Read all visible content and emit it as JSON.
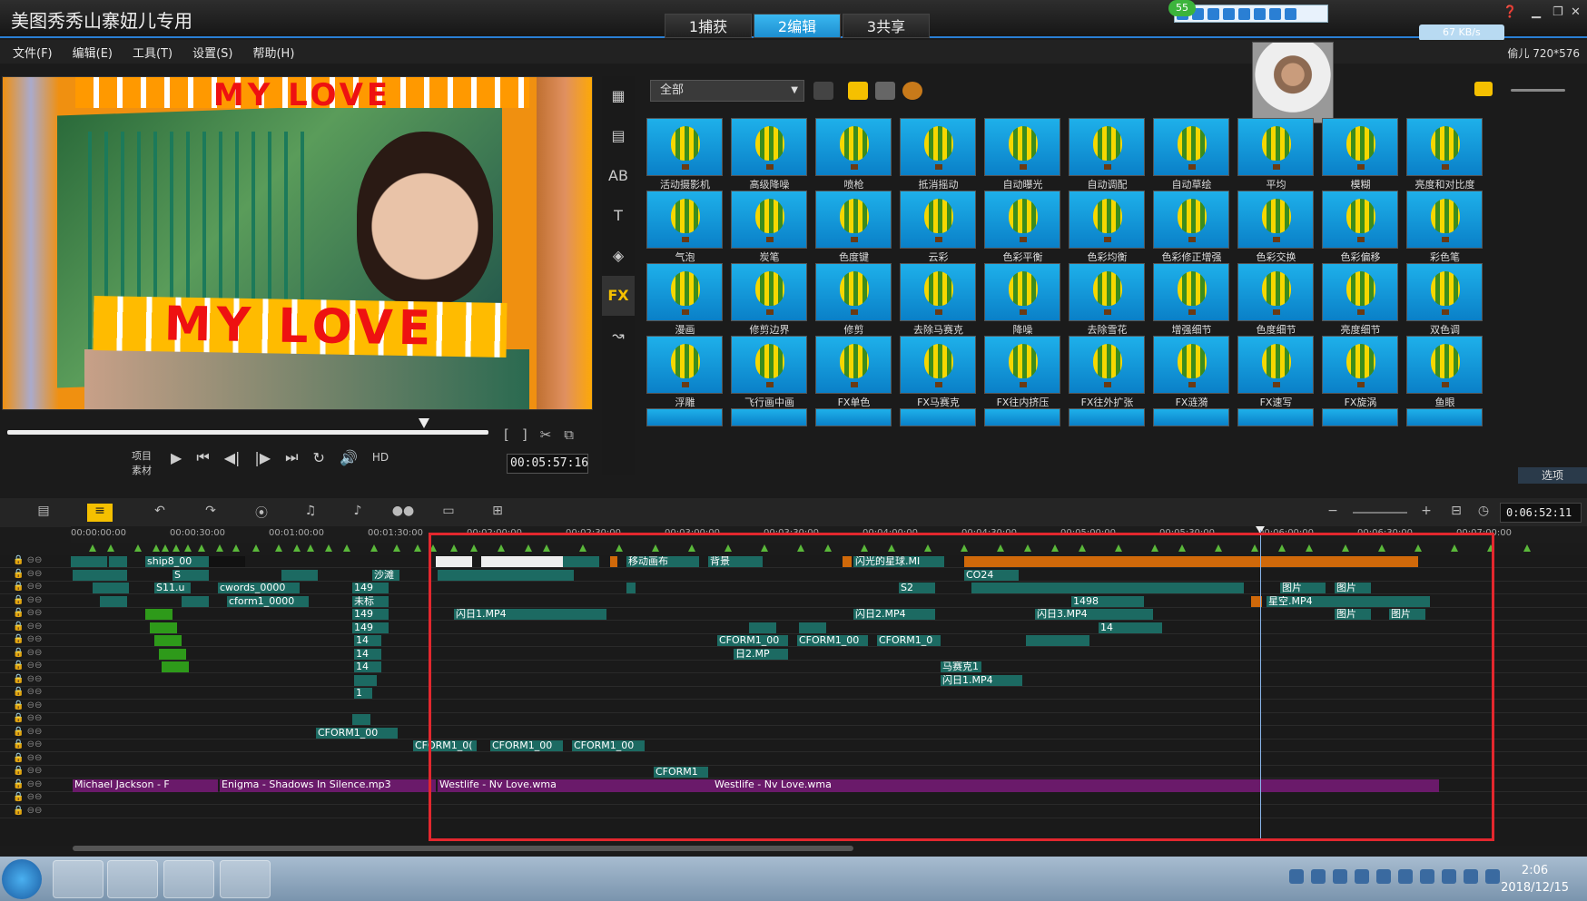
{
  "app": {
    "title": "美图秀秀山寨妞儿专用",
    "mode_tabs": [
      "1捕获",
      "2编辑",
      "3共享"
    ],
    "active_mode": 1
  },
  "menu": [
    "文件(F)",
    "编辑(E)",
    "工具(T)",
    "设置(S)",
    "帮助(H)"
  ],
  "resolution_label": "偷儿 720*576",
  "qq_badge": "55",
  "net_speed": "67 KB/s",
  "preview": {
    "banner_top": "MY LOVE",
    "banner_bottom": "MY LOVE",
    "project_label": "项目",
    "clip_label": "素材",
    "hd_label": "HD",
    "timecode": "00:05:57:16"
  },
  "library": {
    "filter_value": "全部",
    "sidebar": [
      "media-icon",
      "instant-project-icon",
      "transition-icon",
      "title-icon",
      "graphic-icon",
      "filter-icon",
      "path-icon"
    ],
    "options_tab": "选项",
    "effects": [
      "活动摄影机",
      "高级降噪",
      "喷枪",
      "抵消摇动",
      "自动曝光",
      "自动调配",
      "自动草绘",
      "平均",
      "模糊",
      "亮度和对比度",
      "气泡",
      "炭笔",
      "色度键",
      "云彩",
      "色彩平衡",
      "色彩均衡",
      "色彩修正增强",
      "色彩交换",
      "色彩偏移",
      "彩色笔",
      "漫画",
      "修剪边界",
      "修剪",
      "去除马赛克",
      "降噪",
      "去除雪花",
      "增强细节",
      "色度细节",
      "亮度细节",
      "双色调",
      "浮雕",
      "飞行画中画",
      "FX单色",
      "FX马赛克",
      "FX往内挤压",
      "FX往外扩张",
      "FX涟漪",
      "FX速写",
      "FX旋涡",
      "鱼眼"
    ]
  },
  "timeline": {
    "timecode": "0:06:52:11",
    "ruler": [
      "00:00:00:00",
      "00:00:30:00",
      "00:01:00:00",
      "00:01:30:00",
      "00:02:00:00",
      "00:02:30:00",
      "00:03:00:00",
      "00:03:30:00",
      "00:04:00:00",
      "00:04:30:00",
      "00:05:00:00",
      "00:05:30:00",
      "00:06:00:00",
      "00:06:30:00",
      "00:07:00:00"
    ],
    "clips": {
      "ship": "ship8_00",
      "s": "S",
      "s11": "S11.u",
      "cwords": "cwords_0000",
      "cform1": "cform1_0000",
      "n149a": "149",
      "n149b": "149",
      "n149c": "149",
      "n14a": "14",
      "n14b": "14",
      "n14c": "14",
      "n14d": "14",
      "n1": "1",
      "sand": "沙滩",
      "wei": "未标",
      "move": "移动画布",
      "bg": "背景",
      "flash": "闪光的星球.MI",
      "co24": "CO24",
      "s2": "S2",
      "shan1": "闪日1.MP4",
      "shan2": "闪日2.MP4",
      "shan3": "闪日3.MP4",
      "shan1b": "闪日1.MP4",
      "ri2": "日2.MP",
      "n1498": "1498",
      "xingkong": "星空.MP4",
      "tupian1": "图片",
      "tupian2": "图片",
      "tupian3": "图片",
      "tupian4": "图片",
      "majike": "马赛克1",
      "cf1": "CFORM1_00",
      "cf2": "CFORM1_00",
      "cf3": "CFORM1_0",
      "cf4": "CFORM1_00",
      "cf5": "CFORM1_0(",
      "cf6": "CFORM1_00",
      "cf7": "CFORM1_00",
      "cf8": "CFORM1",
      "cf9": "CFORM1_0(",
      "audio1": "Michael Jackson - F",
      "audio2": "Enigma - Shadows In Silence.mp3",
      "audio3": "Westlife - Nv Love.wma",
      "audio4": "Westlife - Nv Love.wma"
    }
  },
  "taskbar": {
    "time": "2:06",
    "date": "2018/12/15"
  },
  "colors": {
    "accent": "#2a7fd4",
    "active_tab": "#3ab8f0",
    "highlight_box": "#e3272e",
    "video_clip": "#1c6a62",
    "audio_clip": "#6a1a6a",
    "overlay_clip": "#d0690a"
  }
}
